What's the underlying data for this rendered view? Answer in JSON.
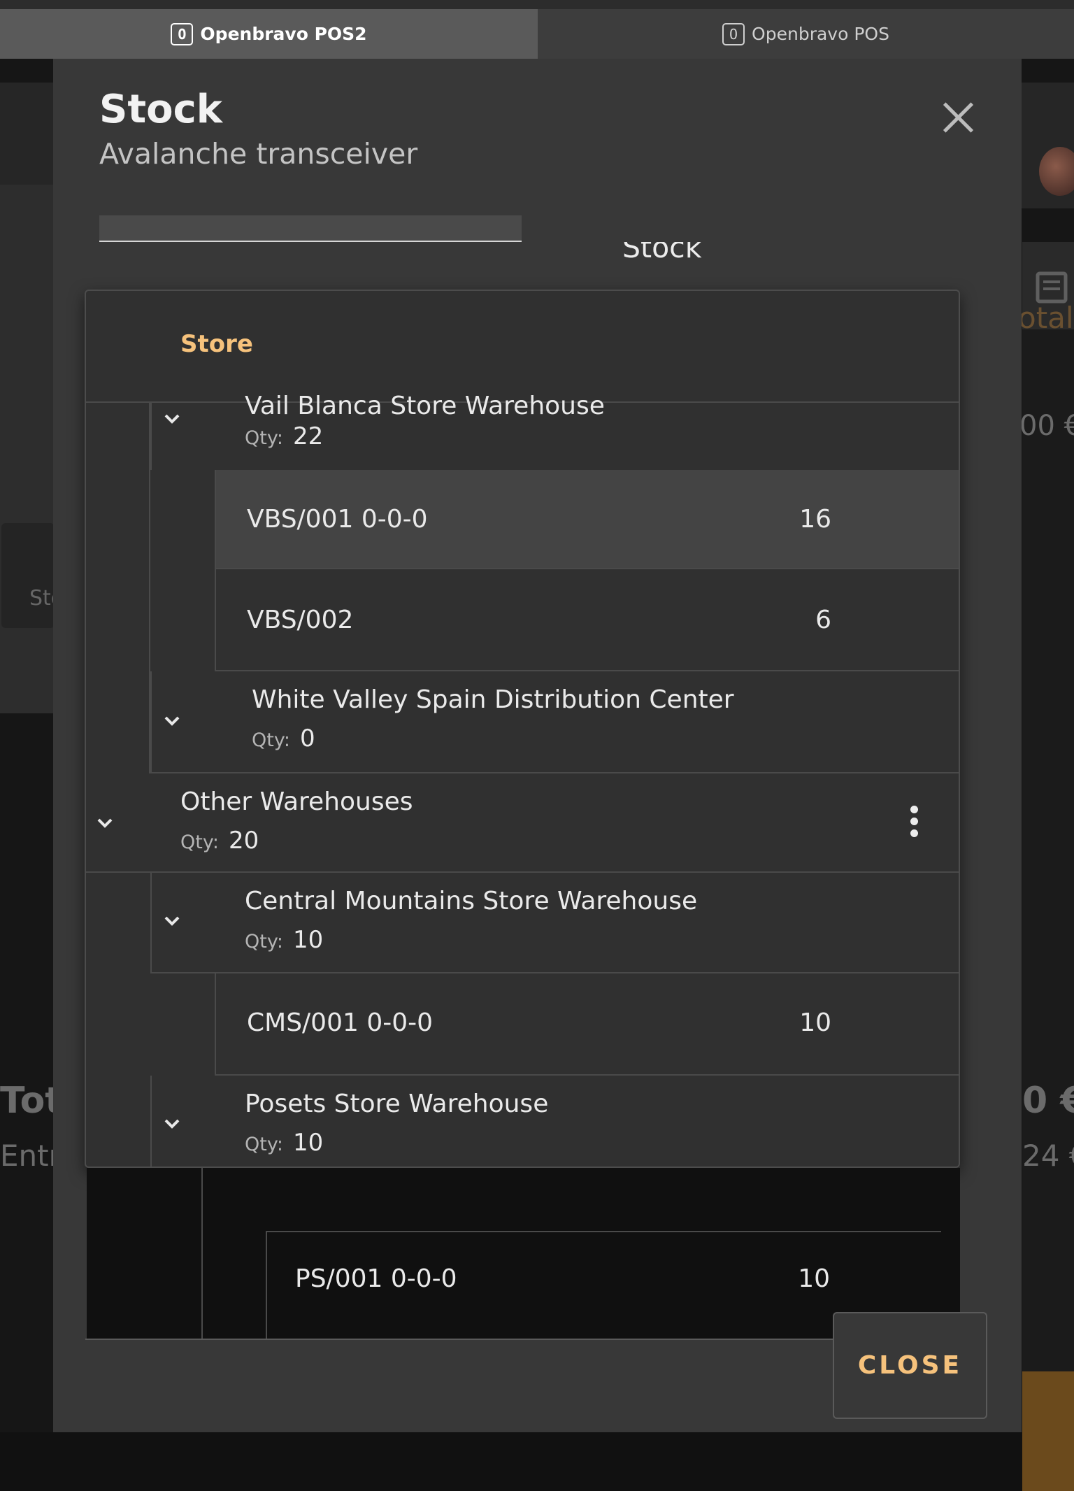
{
  "browser": {
    "tabs": [
      {
        "label": "Openbravo POS2",
        "favicon": "O",
        "active": true
      },
      {
        "label": "Openbravo POS",
        "favicon": "O",
        "active": false
      }
    ]
  },
  "background": {
    "left_button_label": "Sto",
    "right_total_label": "otal",
    "right_amount": "00 €",
    "total_label": "Tot",
    "entries_label": "Entr",
    "total_amount": "0 €",
    "sub_amount": "24 €"
  },
  "modal": {
    "title": "Stock",
    "subtitle": "Avalanche transceiver",
    "filter_value": "",
    "filter_side_label": "Stock",
    "tree": {
      "header": "Store",
      "qty_label": "Qty:",
      "partial_top_row": {
        "title": "Vail Blanca Store Warehouse",
        "qty": "22"
      },
      "bins_vail": [
        {
          "label": "VBS/001 0-0-0",
          "qty": "16",
          "selected": true
        },
        {
          "label": "VBS/002",
          "qty": "6",
          "selected": false
        }
      ],
      "white_valley": {
        "title": "White Valley Spain Distribution Center",
        "qty": "0"
      },
      "other": {
        "title": "Other Warehouses",
        "qty": "20"
      },
      "central": {
        "title": "Central Mountains Store Warehouse",
        "qty": "10"
      },
      "bins_central": [
        {
          "label": "CMS/001 0-0-0",
          "qty": "10"
        }
      ],
      "posets": {
        "title": "Posets Store Warehouse",
        "qty": "10"
      },
      "bins_posets": [
        {
          "label": "PS/001 0-0-0",
          "qty": "10"
        }
      ]
    },
    "close_button": "CLOSE"
  },
  "colors": {
    "accent": "#f6c27c",
    "modal_bg": "#383838",
    "panel_bg": "#303030",
    "selected_row": "#444444"
  }
}
